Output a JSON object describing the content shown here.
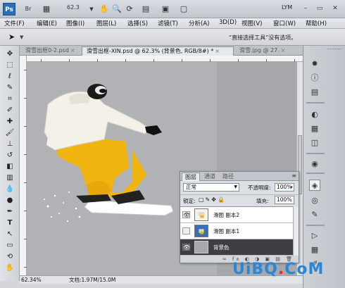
{
  "appbar": {
    "logo": "Ps",
    "zoom": "62.3",
    "user": "LYM",
    "icons": [
      "br-icon",
      "layout-icon",
      "zoom-dropdown-icon",
      "hand-icon",
      "zoom-icon",
      "rotate-icon",
      "grid-icon",
      "screen-mode-icon"
    ]
  },
  "menubar": {
    "items": [
      {
        "label": "文件(F)"
      },
      {
        "label": "编辑(E)"
      },
      {
        "label": "图像(I)"
      },
      {
        "label": "图层(L)"
      },
      {
        "label": "选择(S)"
      },
      {
        "label": "滤镜(T)"
      },
      {
        "label": "分析(A)"
      },
      {
        "label": "3D(D)"
      },
      {
        "label": "视图(V)"
      },
      {
        "label": "窗口(W)"
      },
      {
        "label": "帮助(H)"
      }
    ]
  },
  "optbar": {
    "hint": "“直接选择工具”没有选项。"
  },
  "tabs": [
    {
      "label": "滑雪出框0-2.psd"
    },
    {
      "label": "滑雪出框-XIN.psd @ 62.3% (背景色, RGB/8#) *"
    },
    {
      "label": "滑雪.jpg @ 27."
    }
  ],
  "status": {
    "zoom": "62.34%",
    "doc": "文档:1.97M/15.0M"
  },
  "layers": {
    "tabs": [
      "图层",
      "通道",
      "路径"
    ],
    "blend_mode": "正常",
    "opacity_label": "不透明度:",
    "opacity": "100%",
    "lock_label": "锁定:",
    "fill_label": "填充:",
    "fill": "100%",
    "items": [
      {
        "name": "滑图 副本2",
        "visible": true,
        "selected": false
      },
      {
        "name": "滑图 副本1",
        "visible": false,
        "selected": false
      },
      {
        "name": "背景色",
        "visible": true,
        "selected": true
      }
    ]
  },
  "watermark": {
    "part1": "UiBQ",
    "dot": ".",
    "part2": "CoM"
  },
  "colors": {
    "selected_layer": "#3d3f42",
    "ps_blue": "#2a6fb4",
    "watermark_blue": "#2a86d6",
    "watermark_red": "#e0341e"
  }
}
